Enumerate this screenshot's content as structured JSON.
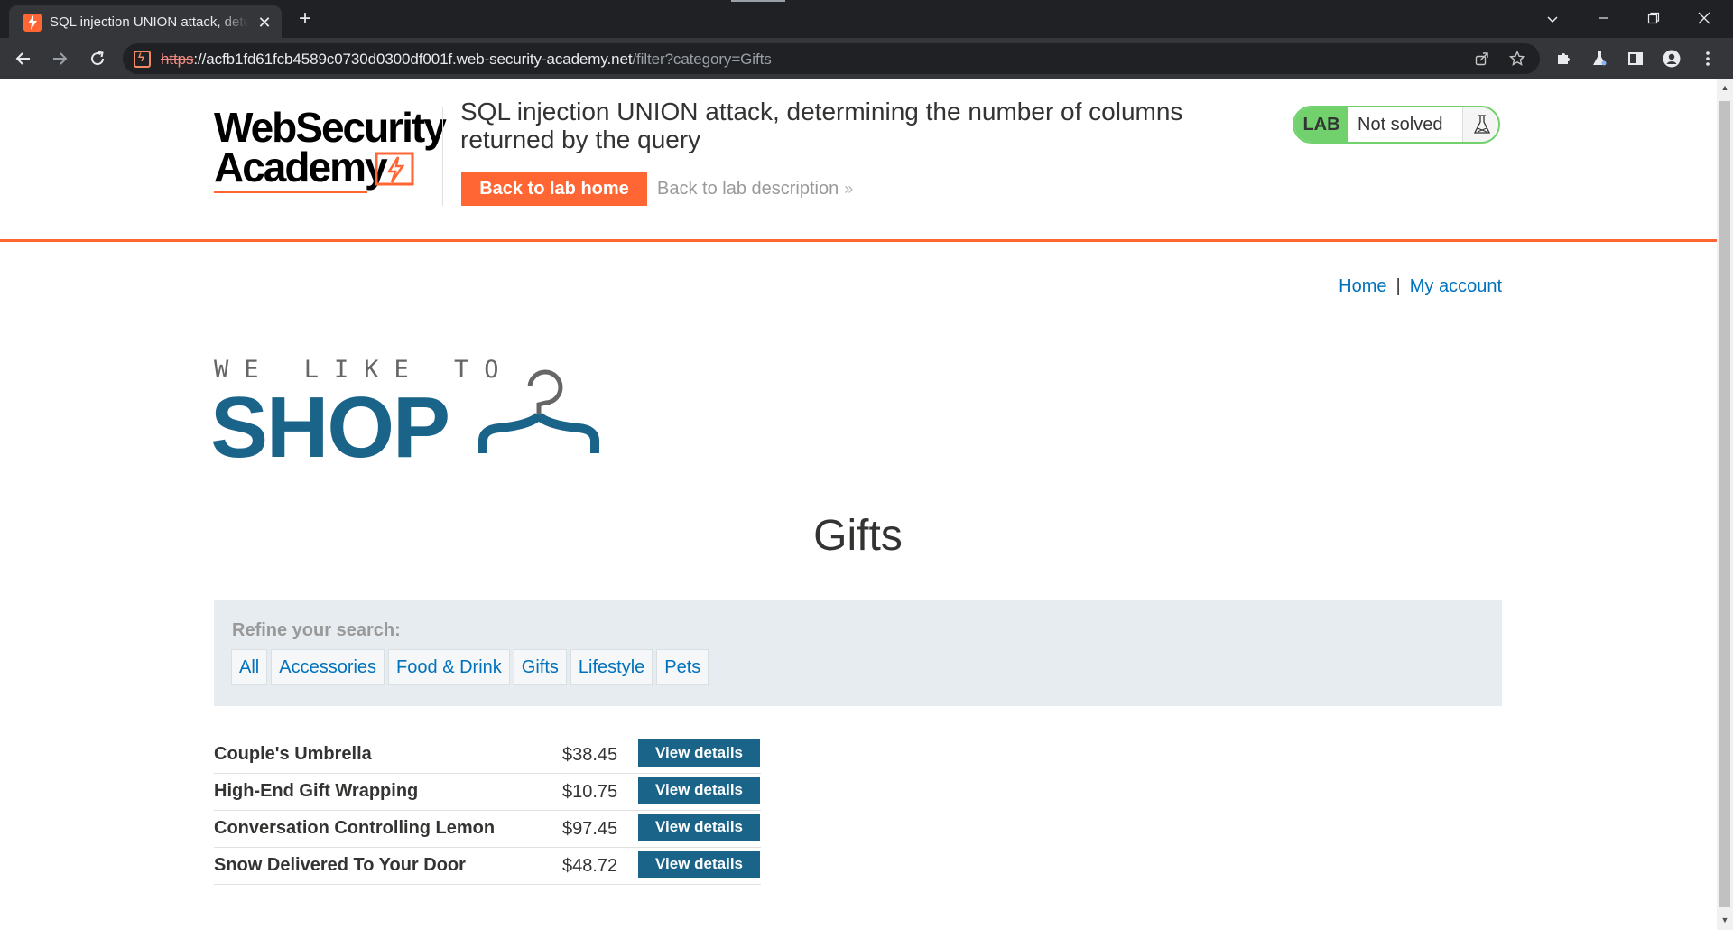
{
  "browser": {
    "tab_title": "SQL injection UNION attack, determining the number of columns returned by the query",
    "url_scheme": "https",
    "url_sep": "://",
    "url_host": "acfb1fd61fcb4589c0730d0300df001f.web-security-academy.net",
    "url_path": "/filter?category=Gifts"
  },
  "academy": {
    "logo_line1": "WebSecurity",
    "logo_line2": "Academy",
    "lab_title": "SQL injection UNION attack, determining the number of columns returned by the query",
    "back_home_label": "Back to lab home",
    "back_desc_label": "Back to lab description",
    "lab_tag": "LAB",
    "lab_state": "Not solved"
  },
  "shop": {
    "nav_home": "Home",
    "nav_sep": "|",
    "nav_account": "My account",
    "tagline": "WE LIKE TO",
    "logo_word": "SHOP",
    "category_title": "Gifts",
    "filter_label": "Refine your search:",
    "filters": [
      "All",
      "Accessories",
      "Food & Drink",
      "Gifts",
      "Lifestyle",
      "Pets"
    ],
    "view_details_label": "View details",
    "products": [
      {
        "name": "Couple's Umbrella",
        "price": "$38.45"
      },
      {
        "name": "High-End Gift Wrapping",
        "price": "$10.75"
      },
      {
        "name": "Conversation Controlling Lemon",
        "price": "$97.45"
      },
      {
        "name": "Snow Delivered To Your Door",
        "price": "$48.72"
      }
    ]
  },
  "colors": {
    "accent_orange": "#ff6633",
    "shop_blue": "#1a6489",
    "link_blue": "#0071bc",
    "lab_green": "#70d16d"
  }
}
